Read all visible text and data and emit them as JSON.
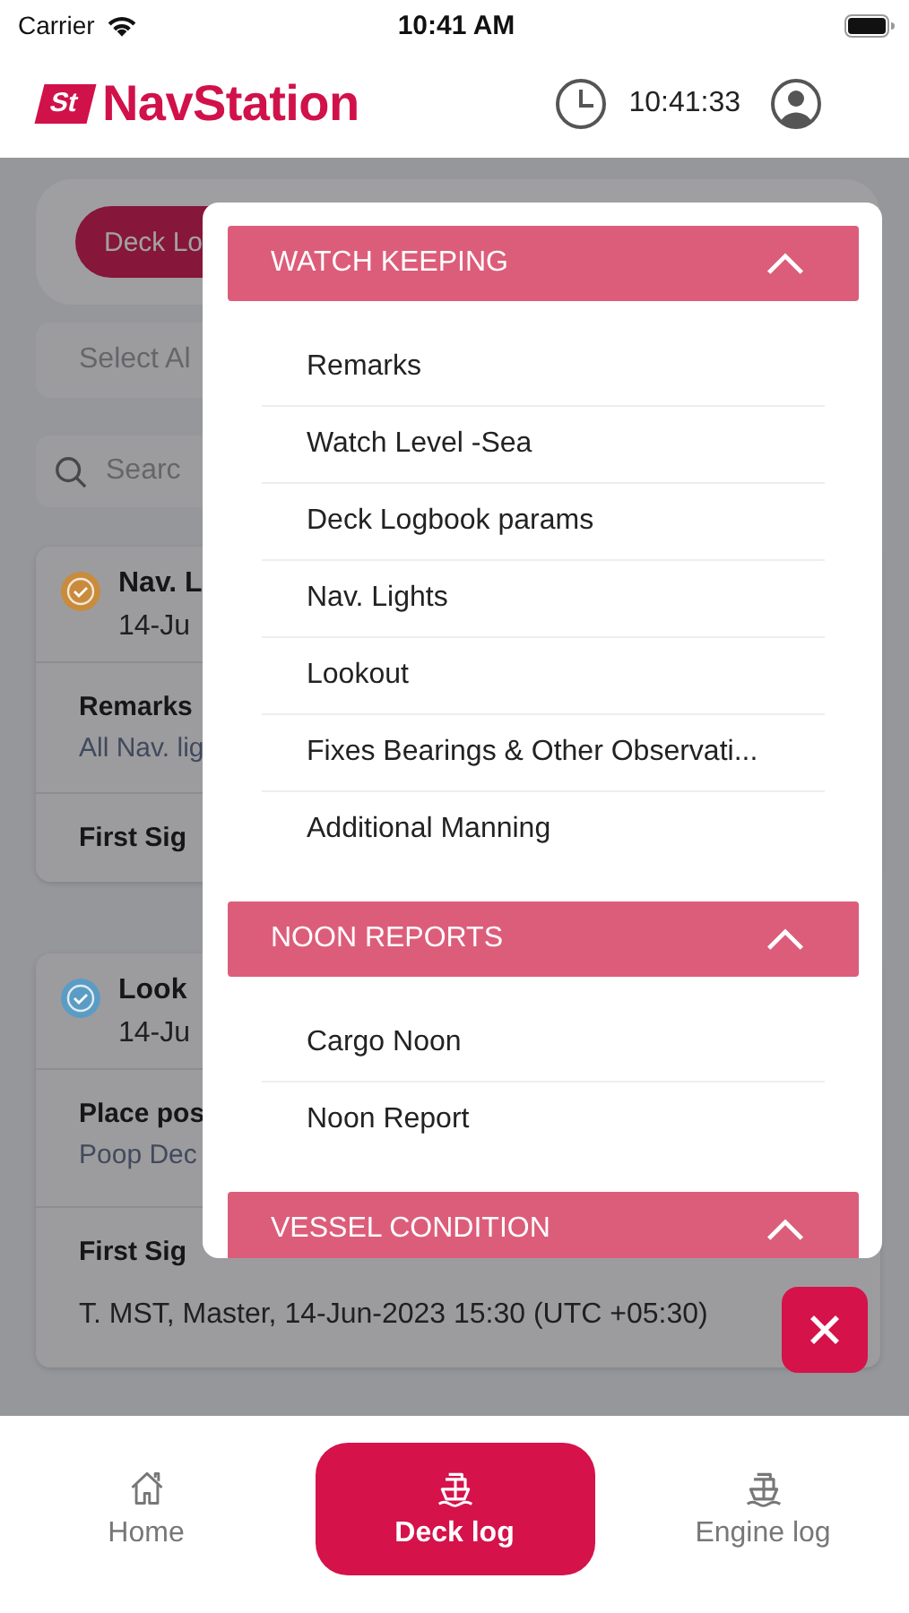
{
  "status_bar": {
    "carrier": "Carrier",
    "time": "10:41 AM"
  },
  "header": {
    "logo_badge": "St",
    "logo_text": "NavStation",
    "clock": "10:41:33"
  },
  "tabs": [
    {
      "label": "Deck Lo",
      "selected": true
    }
  ],
  "select_field": {
    "placeholder": "Select Al"
  },
  "search": {
    "placeholder": "Searc"
  },
  "entries": [
    {
      "title": "Nav. L",
      "date": "14-Ju",
      "color": "#c98b3c",
      "fields": [
        {
          "label": "Remarks",
          "value": "All Nav. lig"
        },
        {
          "label": "First Sig"
        }
      ]
    },
    {
      "title": "Look",
      "date": "14-Ju",
      "color": "#5b9cc4",
      "fields": [
        {
          "label": "Place pos",
          "value": "Poop Dec"
        },
        {
          "label": "First Sig",
          "value": "T. MST, Master, 14-Jun-2023 15:30 (UTC +05:30)"
        }
      ]
    }
  ],
  "menu": {
    "sections": [
      {
        "title": "WATCH KEEPING",
        "expanded": true,
        "items": [
          "Remarks",
          "Watch Level -Sea",
          "Deck Logbook params",
          "Nav. Lights",
          "Lookout",
          "Fixes Bearings & Other Observati...",
          "Additional Manning"
        ]
      },
      {
        "title": "NOON REPORTS",
        "expanded": true,
        "items": [
          "Cargo Noon",
          "Noon Report"
        ]
      },
      {
        "title": "VESSEL CONDITION",
        "expanded": true
      }
    ]
  },
  "bottom_nav": [
    {
      "label": "Home",
      "kind": "home",
      "selected": false
    },
    {
      "label": "Deck log",
      "kind": "ship",
      "selected": true
    },
    {
      "label": "Engine log",
      "kind": "ship",
      "selected": false
    }
  ]
}
